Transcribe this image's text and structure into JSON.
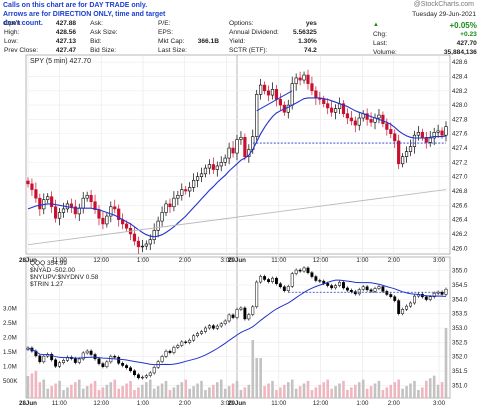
{
  "notice": {
    "line1": "Calls on this chart are for DAY TRADE only.",
    "line2": "Arrows are for DIRECTION ONLY, time and target don't count."
  },
  "brand": "@StockCharts.com",
  "quote": {
    "open_label": "Open:",
    "open": "427.88",
    "high_label": "High:",
    "high": "428.56",
    "low_label": "Low:",
    "low": "427.13",
    "prev_label": "Prev Close:",
    "prev": "427.47",
    "ask_label": "Ask:",
    "ask": "",
    "ask_size_label": "Ask Size:",
    "ask_size": "",
    "bid_label": "Bid:",
    "bid": "",
    "bid_size_label": "Bid Size:",
    "bid_size": "",
    "pe_label": "P/E:",
    "pe": "",
    "eps_label": "EPS:",
    "eps": "",
    "mktcap_label": "Mkt Cap:",
    "mktcap": "366.1B",
    "last_size_label": "Last Size:",
    "last_size": "",
    "options_label": "Options:",
    "options": "yes",
    "dividend_label": "Annual Dividend:",
    "dividend": "5.56325",
    "yield_label": "Yield:",
    "yield": "1.30%",
    "sctr_label": "SCTR (ETF):",
    "sctr": "74.2",
    "date": "Tuesday  29-Jun-2021",
    "change_pct": "+0.05%",
    "chg_label": "Chg:",
    "chg": "+0.23",
    "last_label": "Last:",
    "last": "427.70",
    "volume_label": "Volume:",
    "volume": "35,884,136"
  },
  "colors": {
    "up": "#000000",
    "down": "#c8102e",
    "ma": "#2233cc",
    "ma_long": "#bbbbbb",
    "vol_up": "#c2c2c2",
    "vol_down": "#f0b6bf"
  },
  "chart_data": [
    {
      "type": "candlestick",
      "title": "SPY (5 min) 427.70",
      "x_labels": [
        "28Jun",
        "11:00",
        "12:00",
        "1:00",
        "2:00",
        "3:00",
        "29Jun",
        "11:00",
        "12:00",
        "1:00",
        "2:00",
        "3:00"
      ],
      "y_ticks": [
        426.0,
        426.2,
        426.4,
        426.6,
        426.8,
        427.0,
        427.2,
        427.4,
        427.6,
        427.8,
        428.0,
        428.2,
        428.4,
        428.6
      ],
      "ylim": [
        425.92,
        428.7
      ],
      "close": [
        426.9,
        426.82,
        426.7,
        426.55,
        426.68,
        426.72,
        426.58,
        426.42,
        426.5,
        426.55,
        426.62,
        426.58,
        426.48,
        426.56,
        426.7,
        426.74,
        426.65,
        426.54,
        426.42,
        426.34,
        426.45,
        426.58,
        426.55,
        426.4,
        426.34,
        426.28,
        426.2,
        426.1,
        426.02,
        426.03,
        426.06,
        426.12,
        426.25,
        426.38,
        426.5,
        426.62,
        426.58,
        426.7,
        426.74,
        426.82,
        426.8,
        426.85,
        426.95,
        427.0,
        427.04,
        427.12,
        427.17,
        427.1,
        427.15,
        427.2,
        427.26,
        427.4,
        427.33,
        427.52,
        427.55,
        427.28,
        427.38,
        427.56,
        428.15,
        428.28,
        428.2,
        428.14,
        428.22,
        428.08,
        428.0,
        427.9,
        428.0,
        428.3,
        428.38,
        428.35,
        428.42,
        428.3,
        428.2,
        428.1,
        428.08,
        428.02,
        427.96,
        427.9,
        427.95,
        428.02,
        427.88,
        427.82,
        427.78,
        427.72,
        427.82,
        427.88,
        427.8,
        427.76,
        427.82,
        427.86,
        427.74,
        427.66,
        427.6,
        427.5,
        427.18,
        427.28,
        427.35,
        427.42,
        427.58,
        427.62,
        427.55,
        427.48,
        427.54,
        427.62,
        427.64,
        427.58,
        427.7
      ],
      "ma_short": [
        426.55,
        426.57,
        426.59,
        426.6,
        426.61,
        426.62,
        426.62,
        426.61,
        426.6,
        426.59,
        426.58,
        426.57,
        426.56,
        426.56,
        426.56,
        426.56,
        426.56,
        426.55,
        426.54,
        426.52,
        426.5,
        426.48,
        426.46,
        426.43,
        426.4,
        426.37,
        426.34,
        426.3,
        426.26,
        426.22,
        426.19,
        426.17,
        426.16,
        426.17,
        426.19,
        426.22,
        426.26,
        426.3,
        426.35,
        426.4,
        426.45,
        426.51,
        426.57,
        426.63,
        426.69,
        426.75,
        426.81,
        426.86,
        426.92,
        426.97,
        427.02,
        427.08,
        427.13,
        427.18,
        427.23,
        427.26,
        427.3,
        427.38,
        427.49,
        427.6,
        427.69,
        427.77,
        427.84,
        427.89,
        427.92,
        427.95,
        427.97,
        428.0,
        428.03,
        428.06,
        428.09,
        428.1,
        428.1,
        428.1,
        428.1,
        428.09,
        428.08,
        428.06,
        428.04,
        428.02,
        428.0,
        427.98,
        427.95,
        427.92,
        427.9,
        427.88,
        427.86,
        427.84,
        427.82,
        427.8,
        427.78,
        427.76,
        427.73,
        427.69,
        427.64,
        427.6,
        427.57,
        427.55,
        427.54,
        427.54,
        427.54,
        427.54,
        427.55,
        427.56,
        427.56,
        427.56,
        427.57
      ],
      "ma_long_start": 426.05,
      "ma_long_end": 426.82,
      "reference_line": 427.47,
      "trendline": [
        [
          58,
          427.92
        ],
        [
          67,
          428.2
        ]
      ]
    },
    {
      "type": "line",
      "legend": [
        "QQQ 354.99",
        "$NYAD -502.00",
        "$NYUPV:$NYDNV 0.58",
        "$TRIN 1.27"
      ],
      "y_ticks_right": [
        351.0,
        351.5,
        352.0,
        352.5,
        353.0,
        353.5,
        354.0,
        354.5,
        355.0
      ],
      "ylim_right": [
        350.7,
        355.2
      ],
      "volume_ticks": [
        "500K",
        "1.0M",
        "1.5M",
        "2.0M",
        "2.5M",
        "3.0M"
      ],
      "reference_line": 354.25
    }
  ]
}
